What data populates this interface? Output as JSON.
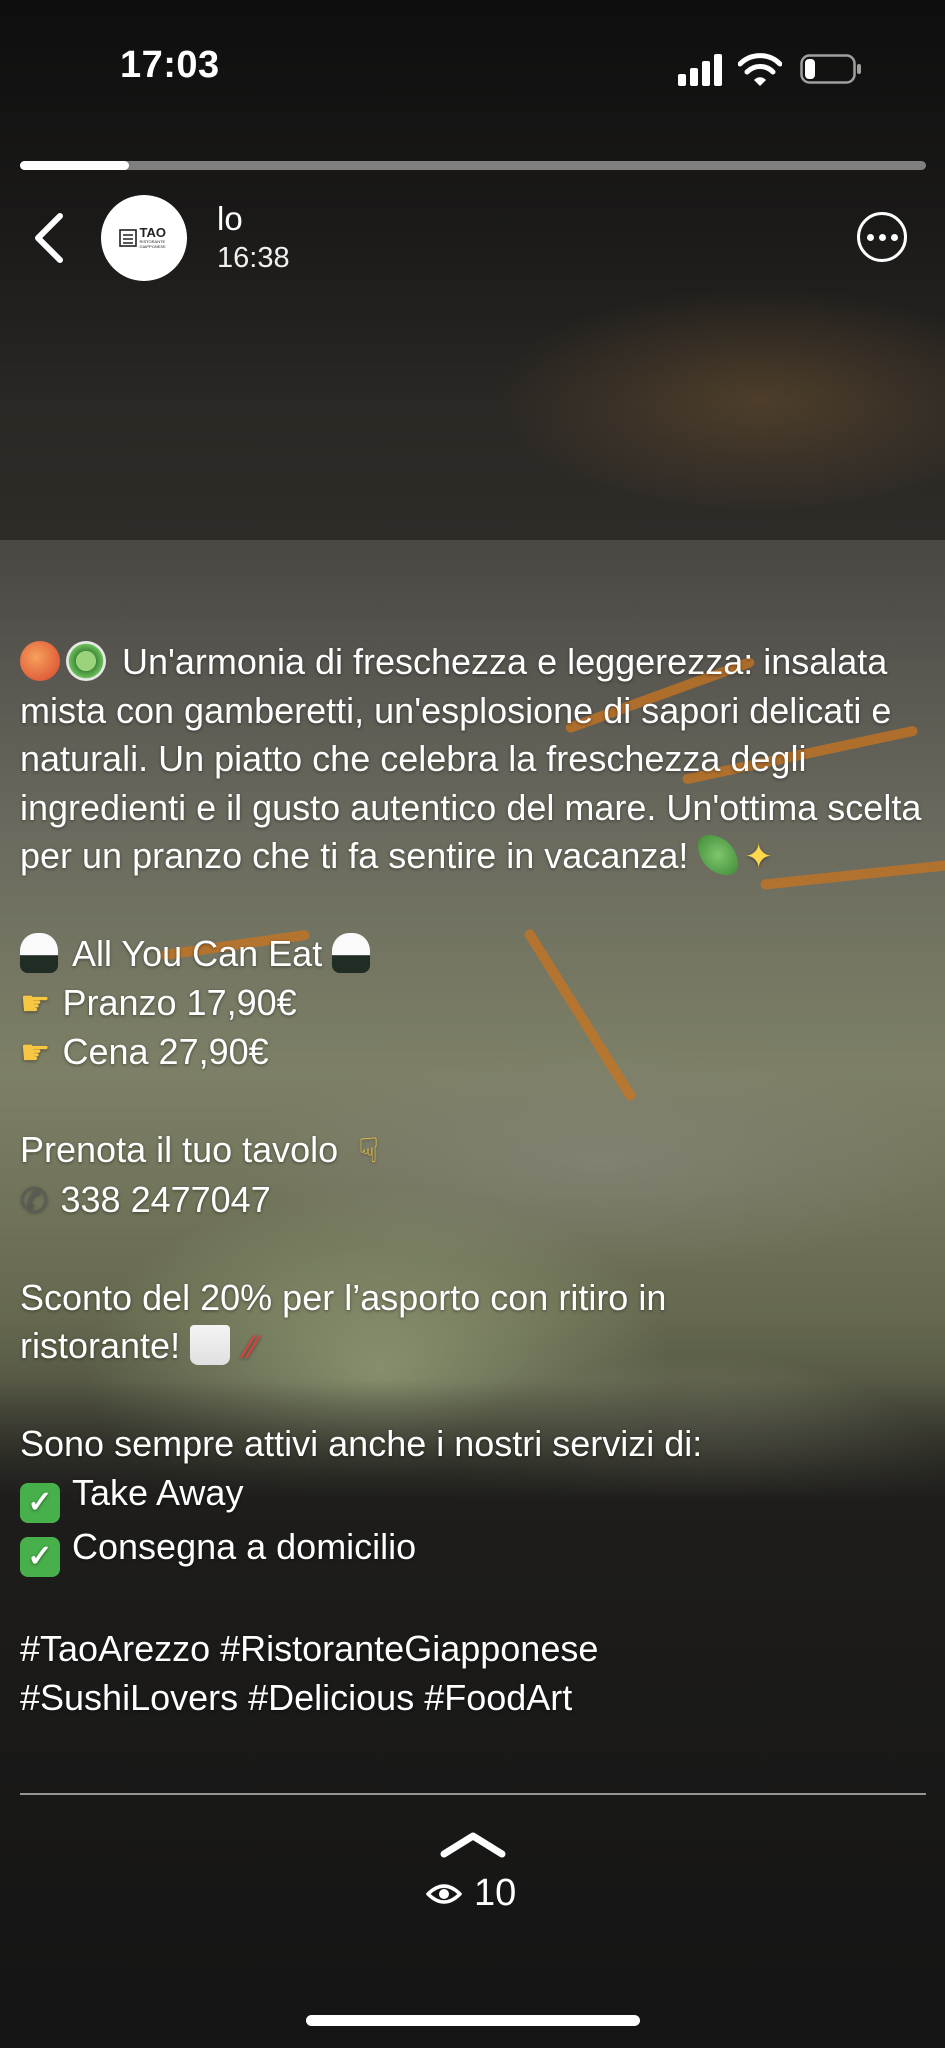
{
  "status_bar": {
    "time": "17:03"
  },
  "story": {
    "progress_fraction": 0.12
  },
  "header": {
    "author": "lo",
    "time": "16:38",
    "avatar_logo_text": "TAO",
    "avatar_logo_subtext": "RISTORANTE GIAPPONESE"
  },
  "caption": {
    "intro": "Un'armonia di freschezza e leggerezza: insalata mista con gamberetti, un'esplosione di sapori delicati e naturali. Un piatto che celebra la freschezza degli ingredienti e il gusto autentico del mare. Un'ottima scelta per un pranzo che ti fa sentire in vacanza!",
    "ayce_title": "All You Can Eat",
    "lunch_price": "Pranzo 17,90€",
    "dinner_price": "Cena 27,90€",
    "booking_prompt": "Prenota il tuo tavolo",
    "phone": "338 2477047",
    "discount_line1": "Sconto del 20% per l’asporto con ritiro in",
    "discount_line2": "ristorante!",
    "services_intro": "Sono sempre attivi anche i nostri servizi di:",
    "service_takeaway": "Take Away",
    "service_delivery": "Consegna a domicilio",
    "hashtags_line1": "#TaoArezzo #RistoranteGiapponese",
    "hashtags_line2": "#SushiLovers #Delicious #FoodArt"
  },
  "footer": {
    "views_count": "10"
  },
  "icons": {
    "back": "chevron-left-icon",
    "more": "more-icon",
    "swipe_up": "chevron-up-icon",
    "views": "eye-icon",
    "emoji": [
      "shrimp",
      "salad",
      "herb",
      "sparkles",
      "rice-ball",
      "pointing-hand",
      "pointing-down-hand",
      "telephone",
      "takeout-box",
      "chopsticks",
      "check-mark"
    ]
  }
}
